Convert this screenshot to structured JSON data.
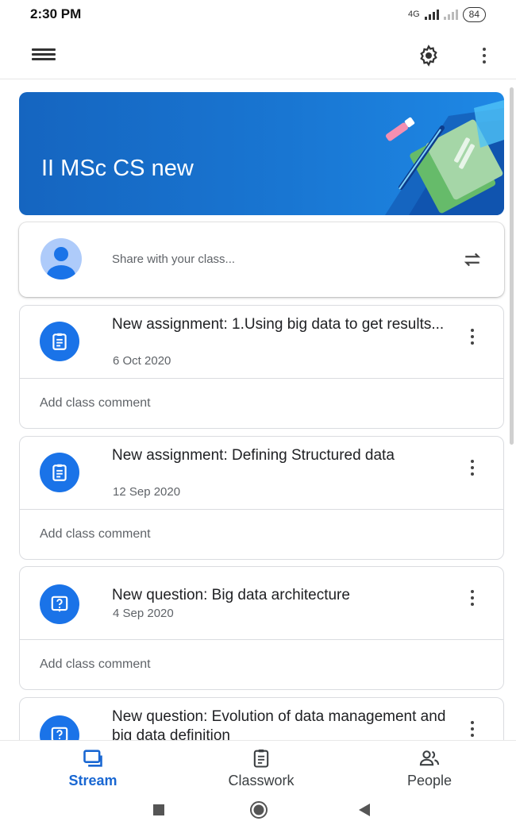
{
  "status_bar": {
    "time": "2:30 PM",
    "network": "4G",
    "battery": "84"
  },
  "app_bar": {
    "menu_icon": "hamburger-menu-icon",
    "settings_icon": "gear-icon",
    "more_icon": "more-vert-icon"
  },
  "banner": {
    "title": "II MSc CS new",
    "color": "#1976d2"
  },
  "share": {
    "placeholder": "Share with your class..."
  },
  "posts": [
    {
      "type": "assignment",
      "icon": "assignment-icon",
      "title": "New assignment: 1.Using big data to get results...",
      "date": "6 Oct 2020",
      "comment": "Add class comment"
    },
    {
      "type": "assignment",
      "icon": "assignment-icon",
      "title": "New assignment: Defining Structured data",
      "date": "12 Sep 2020",
      "comment": "Add class comment"
    },
    {
      "type": "question",
      "icon": "question-icon",
      "title": "New question: Big data architecture",
      "date": "4 Sep 2020",
      "comment": "Add class comment"
    },
    {
      "type": "question",
      "icon": "question-icon",
      "title": "New question: Evolution of data management and big data definition"
    }
  ],
  "bottom_nav": {
    "items": [
      {
        "label": "Stream",
        "icon": "stream-icon",
        "active": true
      },
      {
        "label": "Classwork",
        "icon": "classwork-icon",
        "active": false
      },
      {
        "label": "People",
        "icon": "people-icon",
        "active": false
      }
    ]
  },
  "colors": {
    "accent": "#1a73e8",
    "active_nav": "#1967d2"
  }
}
